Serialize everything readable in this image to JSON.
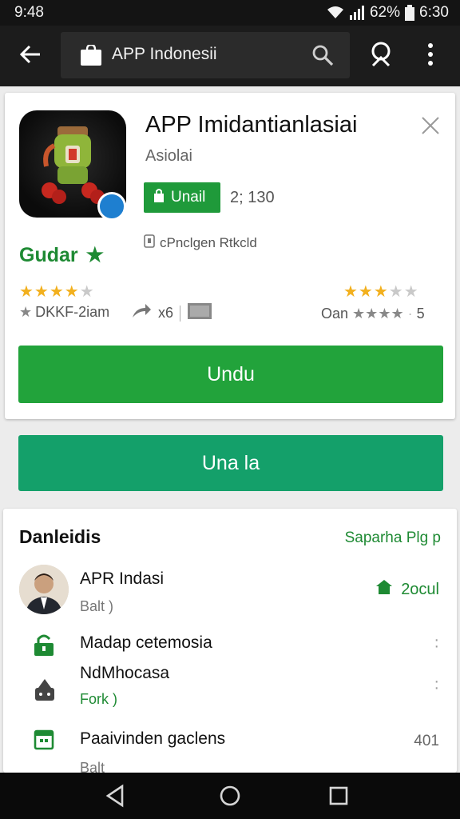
{
  "status": {
    "time": "9:48",
    "battery": "62%",
    "clock": "6:30"
  },
  "toolbar": {
    "search_text": "APP Indonesii"
  },
  "app": {
    "title": "APP Imidantianlasiai",
    "developer": "Asiolai",
    "pill_label": "Unail",
    "pill_count": "2; 130",
    "permission_text": "cPnclgen Rtkcld",
    "guard_label": "Gudar",
    "left_meta": "DKKF-2iam",
    "mid_meta": "x6",
    "right_meta": "Oan",
    "right_meta_num": "5",
    "rating_left_stars": 3.5,
    "rating_right_stars": 2.5,
    "install_label": "Undu",
    "open_label": "Una la"
  },
  "section": {
    "title": "Danleidis",
    "link": "Saparha Plg p",
    "reviewer": {
      "name": "APR Indasi",
      "sub": "Balt",
      "right": "2ocul"
    },
    "items": [
      {
        "label": "Madap cetemosia",
        "sub": ""
      },
      {
        "label": "NdMhocasa",
        "sub": "Fork"
      },
      {
        "label": "Paaivinden gaclens",
        "sub": "Balt",
        "num": "401"
      }
    ]
  },
  "colors": {
    "green": "#22a33b",
    "teal": "#14a06a",
    "dark": "#1c1c1c",
    "star": "#f2b01e"
  },
  "icons": [
    "back-arrow-icon",
    "store-icon",
    "search-icon",
    "bookmark-icon",
    "more-vert-icon",
    "close-icon",
    "share-icon",
    "nav-back-icon",
    "nav-home-icon",
    "nav-recent-icon"
  ]
}
